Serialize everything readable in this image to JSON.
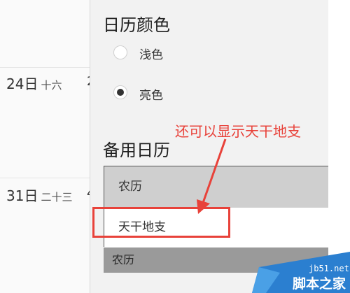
{
  "calendar": {
    "rows": [
      {
        "day": "24日",
        "lunar": "十六",
        "clip": "2"
      },
      {
        "day": "31日",
        "lunar": "二十三",
        "clip": "4"
      }
    ]
  },
  "settings": {
    "color_heading": "日历颜色",
    "color_options": [
      {
        "label": "浅色",
        "selected": false
      },
      {
        "label": "亮色",
        "selected": true
      }
    ],
    "alt_calendar_heading": "备用日历",
    "alt_calendar_options": [
      "农历",
      "天干地支"
    ],
    "alt_calendar_selected": "农历"
  },
  "annotation": {
    "text": "还可以显示天干地支",
    "color": "#e8423a"
  },
  "watermark": {
    "site": "jb51.net",
    "name": "脚本之家"
  }
}
